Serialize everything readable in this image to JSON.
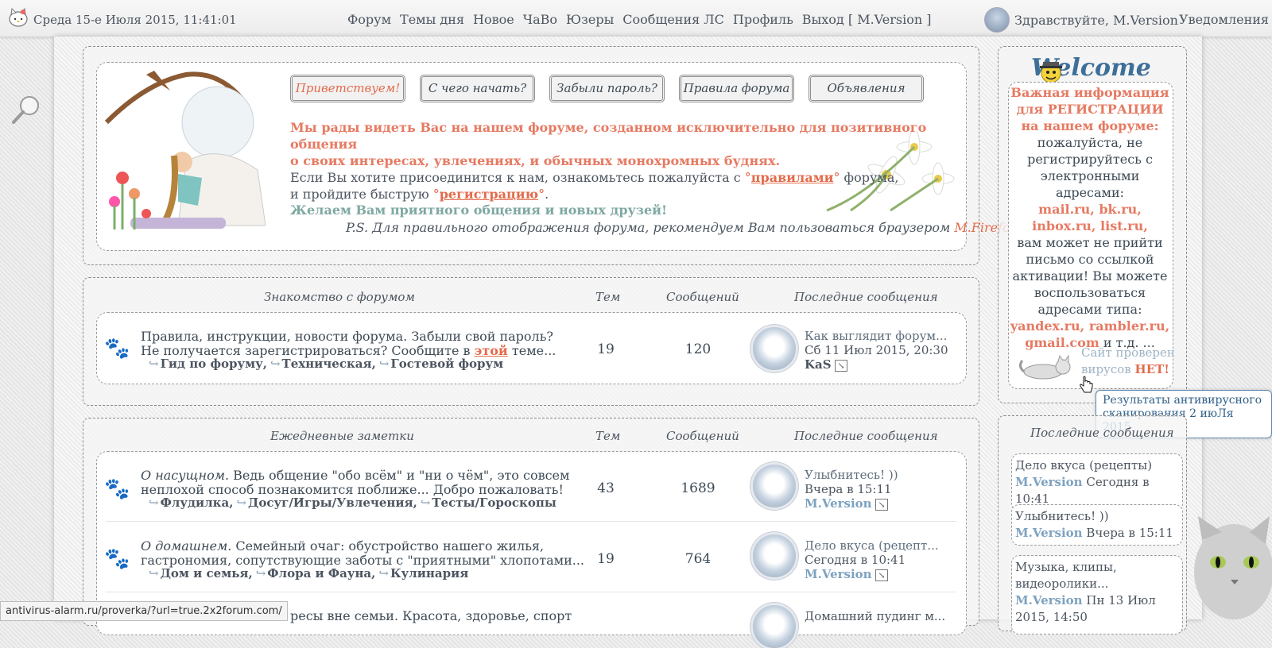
{
  "topbar": {
    "datetime": "Среда 15-е Июля 2015, 11:41:01",
    "nav": [
      "Форум",
      "Темы дня",
      "Новое",
      "ЧаВо",
      "Юзеры",
      "Сообщения ЛС",
      "Профиль",
      "Выход [ M.Version ]"
    ],
    "greeting": "Здравствуйте, M.Version",
    "notifications": "Уведомления"
  },
  "welcome": {
    "tabs": [
      "Приветствуем!",
      "С чего начать?",
      "Забыли пароль?",
      "Правила форума",
      "Объявления"
    ],
    "headline1": "Мы рады видеть Вас на нашем форуме, созданном исключительно для позитивного общения",
    "headline2": "о своих интересах, увлечениях, и обычных монохромных буднях.",
    "body1_pre": "Если Вы хотите присоединится к нам, ознакомьтесь пожалуйста с ",
    "body1_link": "правилами",
    "body1_post": " форума,",
    "body2_pre": "и пройдите быструю ",
    "body2_link": "регистрацию",
    "body2_post": ".",
    "wish": "Желаем Вам приятного общения и новых друзей!",
    "ps_pre": "P.S. Для правильного отображения форума, рекомендуем Вам пользоваться браузером ",
    "ps_browser": "M.Firefox."
  },
  "section1": {
    "title": "Знакомство с форумом",
    "col_topics": "Тем",
    "col_posts": "Сообщений",
    "col_last": "Последние сообщения",
    "row": {
      "desc1": "Правила, инструкции, новости форума. Забыли свой пароль?",
      "desc2_pre": "Не получается зарегистрироваться? Сообщите в ",
      "desc2_link": "этой",
      "desc2_post": " теме...",
      "subs": [
        "Гид по форуму,",
        "Техническая,",
        "Гостевой форум"
      ],
      "topics": "19",
      "posts": "120",
      "last_title": "Как выглядит форум...",
      "last_date": "Сб 11 Июл 2015, 20:30",
      "last_user": "KaS"
    }
  },
  "section2": {
    "title": "Ежедневные заметки",
    "col_topics": "Тем",
    "col_posts": "Сообщений",
    "col_last": "Последние сообщения",
    "rows": [
      {
        "lead": "О насущном.",
        "desc1": " Ведь общение \"обо всём\" и \"ни о чём\", это совсем",
        "desc2": "неплохой способ познакомится поближе... Добро пожаловать!",
        "subs": [
          "Флудилка,",
          "Досуг/Игры/Увлечения,",
          "Тесты/Гороскопы"
        ],
        "topics": "43",
        "posts": "1689",
        "last_title": "Улыбнитесь! ))",
        "last_date": "Вчера в 15:11",
        "last_user": "M.Version"
      },
      {
        "lead": "О домашнем.",
        "desc1": " Семейный очаг: обустройство нашего жилья,",
        "desc2": "гастрономия, сопутствующие заботы с \"приятными\" хлопотами...",
        "subs": [
          "Дом и семья,",
          "Флора и Фауна,",
          "Кулинария"
        ],
        "topics": "19",
        "posts": "764",
        "last_title": "Дело вкуса (рецепт...",
        "last_date": "Сегодня в 10:41",
        "last_user": "M.Version"
      },
      {
        "desc_visible": "ресы вне семьи. Красота, здоровье, спорт",
        "last_title": "Домашний пудинг м..."
      }
    ]
  },
  "sidebar": {
    "welcome_logo": "Welcome",
    "info_title": "Важная информация для РЕГИСТРАЦИИ на нашем форуме:",
    "info_text1": "пожалуйста, не регистрируйтесь с электронными адресами:",
    "info_domains1": "mail.ru, bk.ru, inbox.ru, list.ru,",
    "info_text2": "вам может не прийти письмо со ссылкой активации! Вы можете воспользоваться адресами типа:",
    "info_domains2": "yandex.ru, rambler.ru, gmail.com",
    "info_text3": "и т.д. ...",
    "virus_line1": "Сайт проверен",
    "virus_line2_pre": "вирусов ",
    "virus_line2_bold": "НЕТ!",
    "tooltip1": "Результаты антивирусного",
    "tooltip2": "сканирования 2 июЛя 2015",
    "last_posts_title": "Последние сообщения",
    "last_posts": [
      {
        "title": "Дело вкуса (рецепты)",
        "user": "M.Version",
        "date": "Сегодня в 10:41"
      },
      {
        "title": "Улыбнитесь! ))",
        "user": "M.Version",
        "date": "Вчера в 15:11"
      },
      {
        "title": "Музыка, клипы, видеоролики...",
        "user": "M.Version",
        "date": "Пн 13 Июл 2015, 14:50"
      }
    ]
  },
  "statusbar": "antivirus-alarm.ru/proverka/?url=true.2x2forum.com/"
}
